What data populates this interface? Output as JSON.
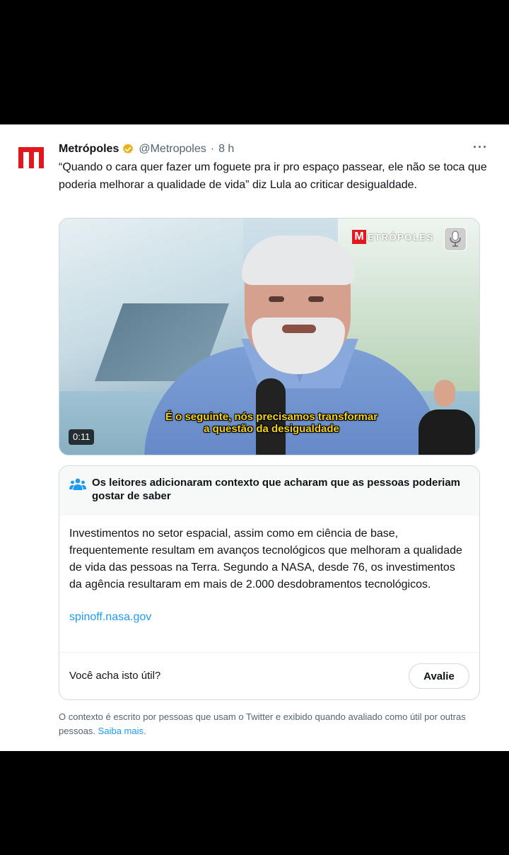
{
  "tweet": {
    "author_name": "Metrópoles",
    "handle": "@Metropoles",
    "separator": "·",
    "time": "8 h",
    "more_label": "···",
    "text": "“Quando o cara quer fazer um foguete pra ir pro espaço passear, ele não se toca que poderia melhorar a qualidade de vida” diz Lula ao criticar desigualdade.",
    "avatar_letter": "M",
    "brand_color": "#e2181f",
    "verified_color": "#e8b21b"
  },
  "video": {
    "logo_letter": "M",
    "logo_text": "ETRÓPOLES",
    "caption_line1": "É o seguinte, nós precisamos transformar",
    "caption_line2": "a questão da desigualdade",
    "duration": "0:11",
    "badge_icon": "microphone-icon"
  },
  "community_note": {
    "icon": "people-icon",
    "title": "Os leitores adicionaram contexto que acharam que as pessoas poderiam gostar de saber",
    "body": "Investimentos no setor espacial, assim como em ciência de base, frequentemente resultam em avanços tecnológicos que melhoram a qualidade de vida das pessoas na Terra. Segundo a NASA, desde 76, os investimentos da agência resultaram em mais de 2.000 desdobramentos tecnológicos.",
    "link": "spinoff.nasa.gov",
    "question": "Você acha isto útil?",
    "rate_button": "Avalie"
  },
  "footer": {
    "text": "O contexto é escrito por pessoas que usam o Twitter e exibido quando avaliado como útil por outras pessoas.",
    "link": "Saiba mais."
  }
}
